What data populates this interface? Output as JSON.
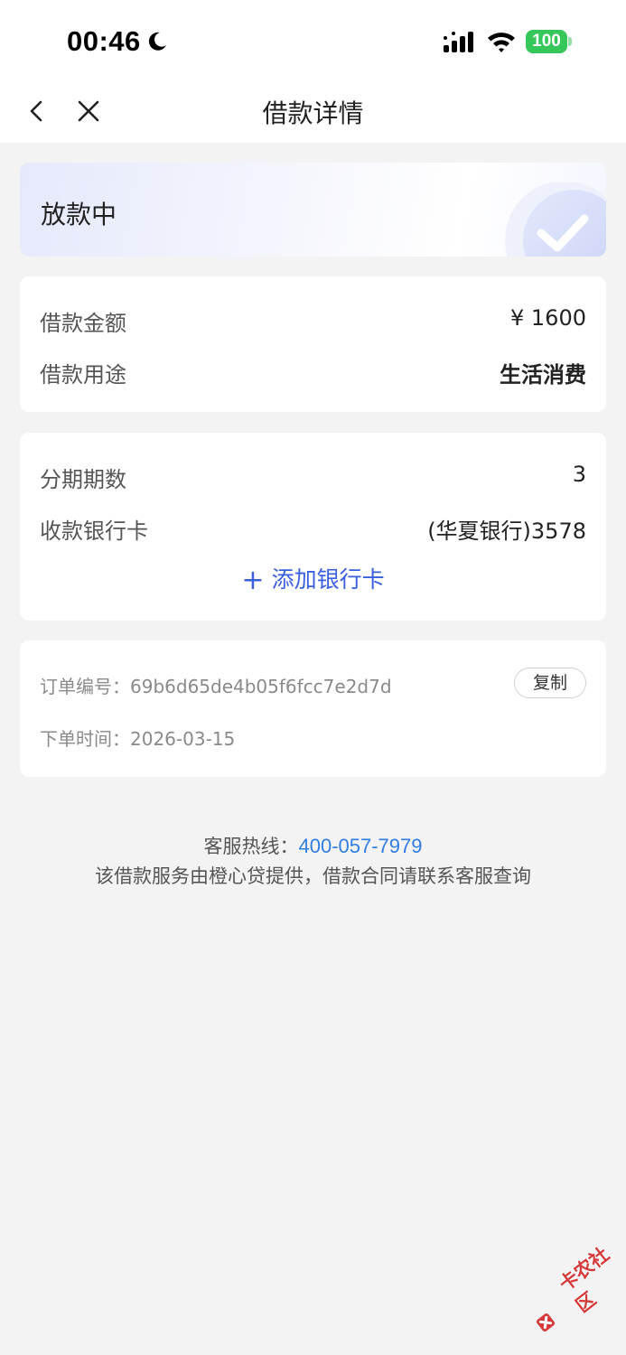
{
  "status_bar": {
    "time": "00:46",
    "battery": "100",
    "icons": [
      "moon-icon",
      "signal-icon",
      "wifi-icon",
      "battery-icon"
    ]
  },
  "nav": {
    "title": "借款详情",
    "icons": [
      "back-icon",
      "close-icon"
    ]
  },
  "status_card": {
    "text": "放款中",
    "icon": "check-icon"
  },
  "loan_info": {
    "amount_label": "借款金额",
    "amount_value": "¥ 1600",
    "purpose_label": "借款用途",
    "purpose_value": "生活消费"
  },
  "installment": {
    "periods_label": "分期期数",
    "periods_value": "3",
    "bank_label": "收款银行卡",
    "bank_value": "(华夏银行)3578",
    "add_card_plus": "+",
    "add_card_label": "添加银行卡"
  },
  "order": {
    "number_label": "订单编号：",
    "number_value": "69b6d65de4b05f6fcc7e2d7d",
    "copy_label": "复制",
    "time_label": "下单时间：",
    "time_value": "2026-03-15"
  },
  "footer": {
    "hotline_label": "客服热线：",
    "hotline_number": "400-057-7979",
    "notice": "该借款服务由橙心贷提供，借款合同请联系客服查询"
  },
  "watermark": {
    "text": "卡农社区"
  },
  "colors": {
    "background": "#f3f3f4",
    "accent_blue": "#3a5ee0",
    "link_blue": "#2f7de1",
    "battery_green": "#35c759"
  }
}
